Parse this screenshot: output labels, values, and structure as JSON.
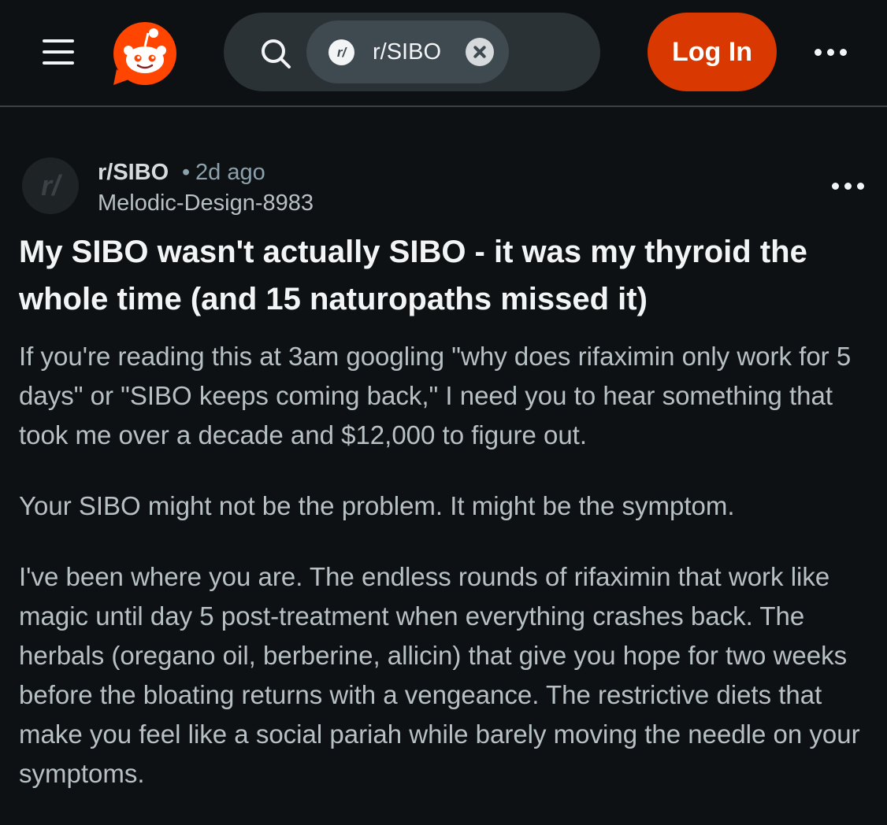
{
  "header": {
    "menu_icon": "hamburger-menu-icon",
    "logo_icon": "reddit-logo-icon",
    "search_icon": "search-icon",
    "search_chip": {
      "icon": "subreddit-icon",
      "icon_text": "r/",
      "label": "r/SIBO",
      "close_icon": "close-icon"
    },
    "login_label": "Log In",
    "more_icon": "more-dots-icon",
    "accent_color": "#d93900"
  },
  "post": {
    "avatar_text": "r/",
    "subreddit": "r/SIBO",
    "separator": "•",
    "time": "2d ago",
    "author": "Melodic-Design-8983",
    "more_icon": "more-dots-icon",
    "title": "My SIBO wasn't actually SIBO - it was my thyroid the whole time (and 15 naturopaths missed it)",
    "paragraphs": [
      "If you're reading this at 3am googling \"why does rifaximin only work for 5 days\" or \"SIBO keeps coming back,\" I need you to hear something that took me over a decade and $12,000 to figure out.",
      "Your SIBO might not be the problem. It might be the symptom.",
      "I've been where you are. The endless rounds of rifaximin that work like magic until day 5 post-treatment when everything crashes back. The herbals (oregano oil, berberine, allicin) that give you hope for two weeks before the bloating returns with a vengeance. The restrictive diets that make you feel like a social pariah while barely moving the needle on your symptoms."
    ]
  }
}
